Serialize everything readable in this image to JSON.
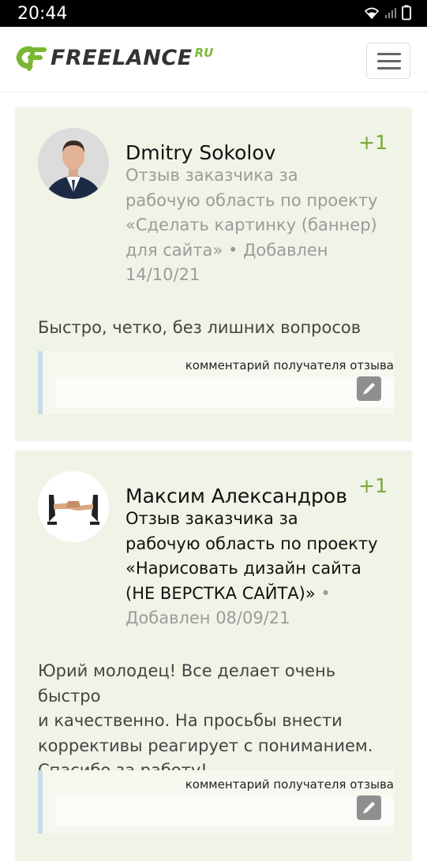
{
  "status_bar": {
    "time": "20:44"
  },
  "header": {
    "logo_main": "FREELANCE",
    "logo_suffix": "RU"
  },
  "reviews": [
    {
      "name": "Dmitry Sokolov",
      "plus": "+1",
      "meta_lines": [
        "Отзыв заказчика за",
        "рабочую область по проекту",
        "«Сделать картинку (баннер)",
        "для сайта» • Добавлен",
        "14/10/21"
      ],
      "text_lines": [
        "Быстро, четко, без лишних вопросов"
      ],
      "comment_label": "комментарий получателя отзыва"
    },
    {
      "name": "Максим Александров",
      "plus": "+1",
      "meta_lines": [
        "Отзыв заказчика за",
        "рабочую область по проекту",
        "«Нарисовать дизайн сайта",
        "(НЕ ВЕРСТКА САЙТА)»",
        " •",
        "Добавлен 08/09/21"
      ],
      "text_lines": [
        "Юрий молодец! Все делает очень быстро",
        "и качественно. На просьбы внести",
        "коррективы реагирует с пониманием.",
        "Спасибо за работу!"
      ],
      "comment_label": "комментарий получателя отзыва"
    }
  ],
  "colors": {
    "card_bg": "#eff4e7",
    "accent_green": "#7aa83a",
    "comment_border": "#c8dbe8"
  }
}
